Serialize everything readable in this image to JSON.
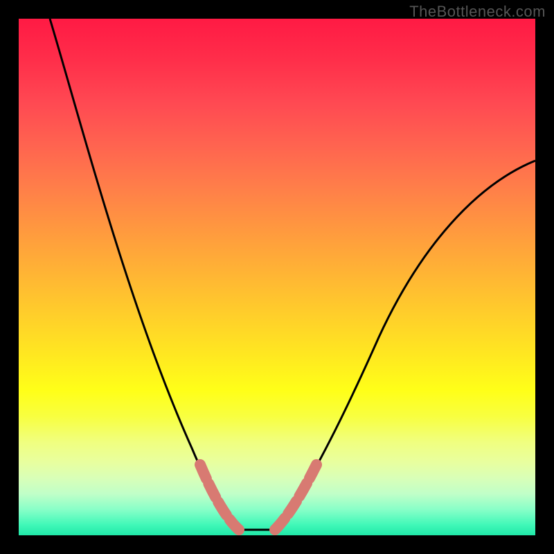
{
  "watermark": "TheBottleneck.com",
  "chart_data": {
    "type": "line",
    "title": "",
    "xlabel": "",
    "ylabel": "",
    "x": [
      0.06,
      0.1,
      0.15,
      0.2,
      0.25,
      0.3,
      0.35,
      0.4,
      0.43,
      0.46,
      0.5,
      0.55,
      0.6,
      0.65,
      0.7,
      0.8,
      0.9,
      1.0
    ],
    "values": [
      1.0,
      0.86,
      0.7,
      0.55,
      0.4,
      0.27,
      0.16,
      0.07,
      0.02,
      0.01,
      0.01,
      0.05,
      0.14,
      0.27,
      0.38,
      0.55,
      0.66,
      0.72
    ],
    "xlim": [
      0,
      1
    ],
    "ylim": [
      0,
      1
    ],
    "background_gradient": {
      "top": "#ff1a44",
      "mid": "#ffe422",
      "bottom": "#20e8a8"
    },
    "highlight_region_x": [
      0.35,
      0.58
    ],
    "highlight_color": "#d87a72",
    "frame_color": "#000000"
  }
}
